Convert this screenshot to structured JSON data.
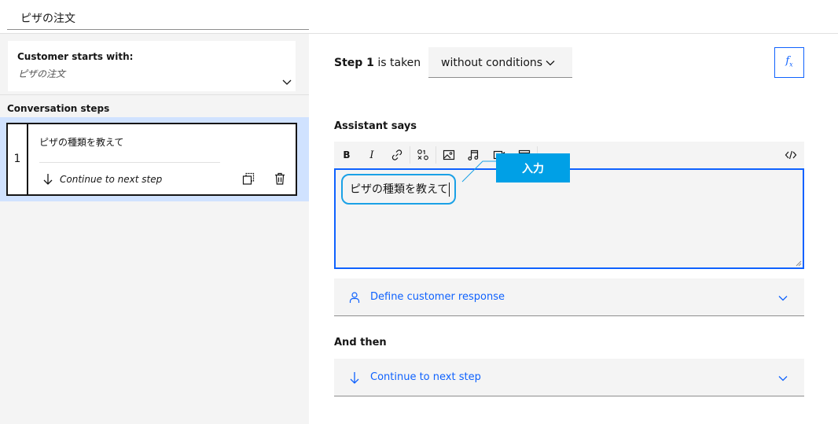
{
  "title_bar": {
    "value": "ピザの注文"
  },
  "left_panel": {
    "start_card": {
      "label": "Customer starts with:",
      "value": "ピザの注文"
    },
    "steps_heading": "Conversation steps",
    "steps": [
      {
        "number": "1",
        "text": "ピザの種類を教えて",
        "next_label": "Continue to next step"
      }
    ]
  },
  "condition": {
    "step_word": "Step 1",
    "is_taken": " is taken",
    "dropdown_value": "without conditions",
    "fx_label": "f",
    "fx_sub": "x"
  },
  "assistant": {
    "heading": "Assistant says",
    "editor_text": "ピザの種類を教えて",
    "toolbar": {
      "bold": "B",
      "italic": "I",
      "items": [
        "bold",
        "italic",
        "link",
        "variable",
        "image",
        "audio",
        "video",
        "iframe",
        "code"
      ]
    }
  },
  "callout": {
    "label": "入力",
    "color": "#00a0e6"
  },
  "customer_response": {
    "label": "Define customer response"
  },
  "and_then": {
    "heading": "And then",
    "label": "Continue to next step"
  },
  "colors": {
    "accent": "#0f62fe",
    "selected_row": "#d0e2ff",
    "panel": "#f4f4f4"
  }
}
